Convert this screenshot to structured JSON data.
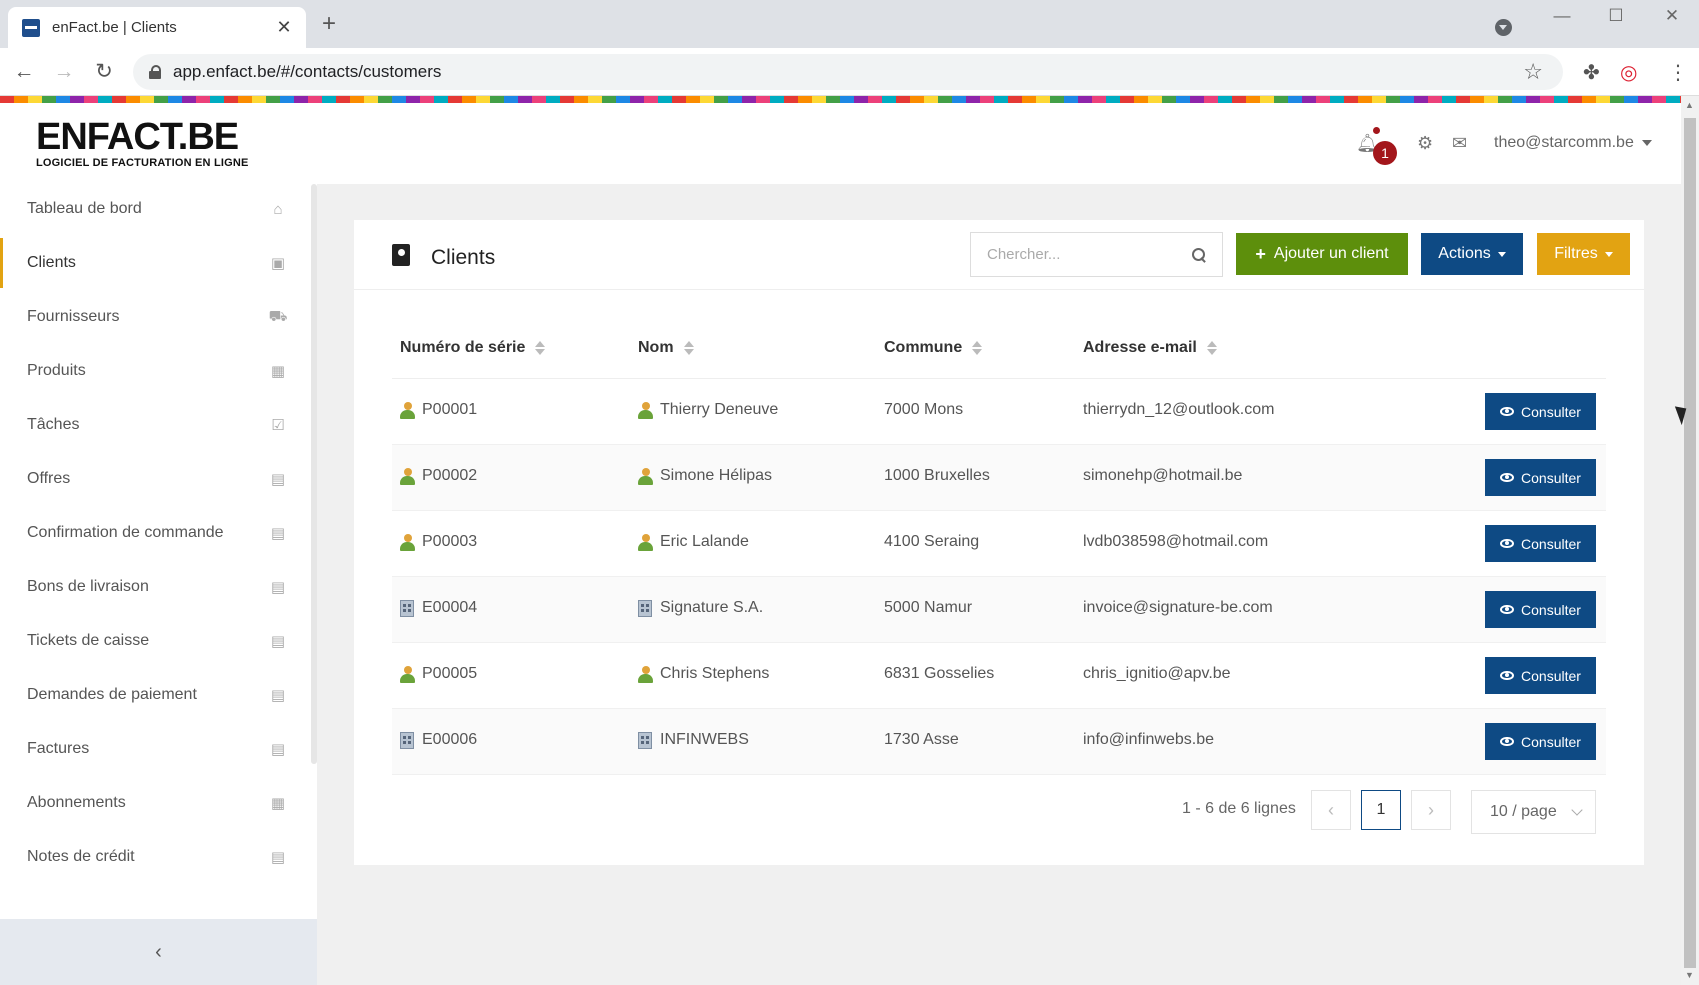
{
  "browser": {
    "tab_title": "enFact.be | Clients",
    "tab_close": "✕",
    "new_tab": "+",
    "url": "app.enfact.be/#/contacts/customers",
    "min": "—",
    "max": "☐",
    "close": "✕"
  },
  "header": {
    "logo_main": "ENFACT.BE",
    "logo_sub": "LOGICIEL DE FACTURATION EN LIGNE",
    "notification_count": "1",
    "user_email": "theo@starcomm.be"
  },
  "sidebar": {
    "items": [
      {
        "label": "Tableau de bord",
        "icon": "⌂"
      },
      {
        "label": "Clients",
        "icon": "▣"
      },
      {
        "label": "Fournisseurs",
        "icon": "⛟"
      },
      {
        "label": "Produits",
        "icon": "▦"
      },
      {
        "label": "Tâches",
        "icon": "☑"
      },
      {
        "label": "Offres",
        "icon": "▤"
      },
      {
        "label": "Confirmation de commande",
        "icon": "▤"
      },
      {
        "label": "Bons de livraison",
        "icon": "▤"
      },
      {
        "label": "Tickets de caisse",
        "icon": "▤"
      },
      {
        "label": "Demandes de paiement",
        "icon": "▤"
      },
      {
        "label": "Factures",
        "icon": "▤"
      },
      {
        "label": "Abonnements",
        "icon": "▦"
      },
      {
        "label": "Notes de crédit",
        "icon": "▤"
      }
    ],
    "collapse_icon": "‹"
  },
  "main": {
    "title": "Clients",
    "search_placeholder": "Chercher...",
    "add_button": "Ajouter un client",
    "actions_button": "Actions",
    "filters_button": "Filtres",
    "columns": [
      "Numéro de série",
      "Nom",
      "Commune",
      "Adresse e-mail"
    ],
    "consult_label": "Consulter",
    "rows": [
      {
        "serial": "P00001",
        "name": "Thierry Deneuve",
        "commune": "7000 Mons",
        "email": "thierrydn_12@outlook.com",
        "type": "person"
      },
      {
        "serial": "P00002",
        "name": "Simone Hélipas",
        "commune": "1000 Bruxelles",
        "email": "simonehp@hotmail.be",
        "type": "person"
      },
      {
        "serial": "P00003",
        "name": "Eric Lalande",
        "commune": "4100 Seraing",
        "email": "lvdb038598@hotmail.com",
        "type": "person"
      },
      {
        "serial": "E00004",
        "name": "Signature S.A.",
        "commune": "5000 Namur",
        "email": "invoice@signature-be.com",
        "type": "company"
      },
      {
        "serial": "P00005",
        "name": "Chris Stephens",
        "commune": "6831 Gosselies",
        "email": "chris_ignitio@apv.be",
        "type": "person"
      },
      {
        "serial": "E00006",
        "name": "INFINWEBS",
        "commune": "1730 Asse",
        "email": "info@infinwebs.be",
        "type": "company"
      }
    ],
    "pagination": {
      "total": "1 - 6 de 6 lignes",
      "prev": "‹",
      "current_page": "1",
      "next": "›",
      "page_size": "10 / page"
    }
  }
}
